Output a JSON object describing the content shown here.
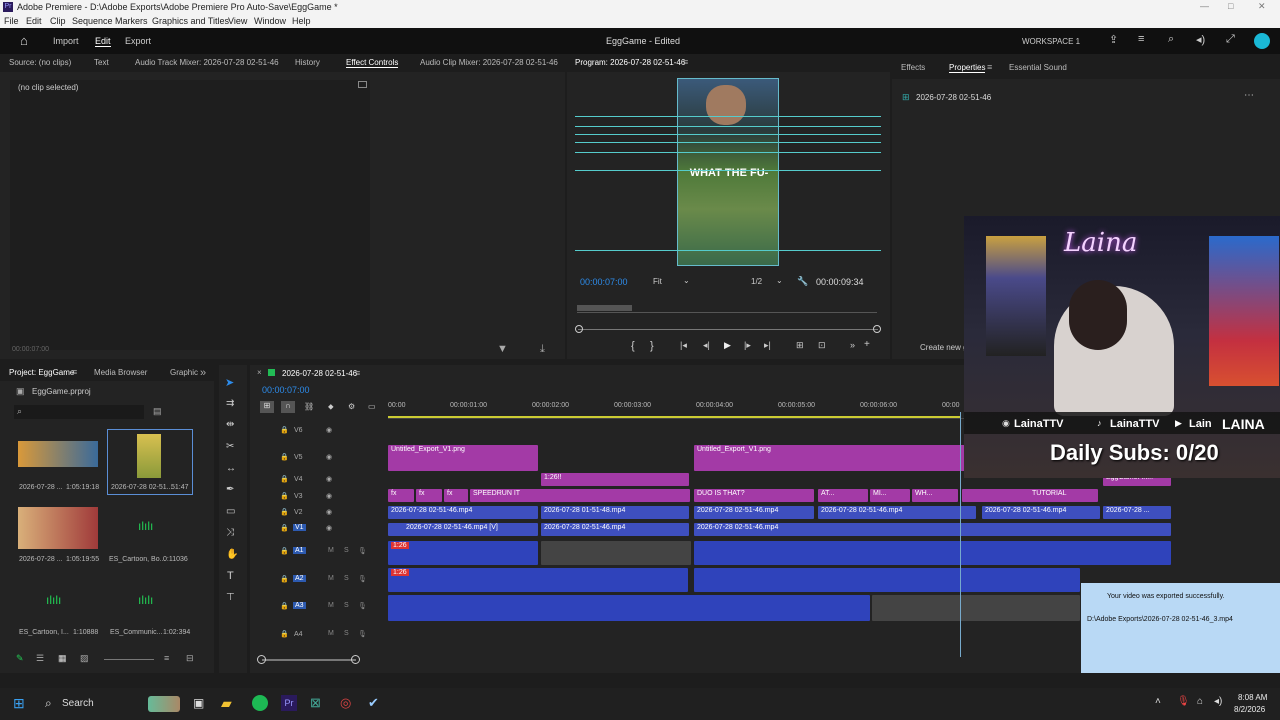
{
  "window": {
    "title": "Adobe Premiere - D:\\Adobe Exports\\Adobe Premiere Pro Auto-Save\\EggGame *",
    "controls": [
      "—",
      "□",
      "✕"
    ]
  },
  "menu": [
    "File",
    "Edit",
    "Clip",
    "Sequence",
    "Markers",
    "Graphics and Titles",
    "View",
    "Window",
    "Help"
  ],
  "appbar": {
    "nav": [
      "Import",
      "Edit",
      "Export"
    ],
    "title": "EggGame - Edited",
    "workspace": "WORKSPACE 1"
  },
  "source_panel": {
    "tabs": [
      "Source: (no clips)",
      "Text",
      "Audio Track Mixer: 2026-07-28 02-51-46",
      "History",
      "Effect Controls",
      "Audio Clip Mixer: 2026-07-28 02-51-46"
    ],
    "status": "(no clip selected)",
    "timecode": "00:00:07:00"
  },
  "program": {
    "title": "Program: 2026-07-28 02-51-46",
    "caption": "WHAT THE FU-",
    "timecode": "00:00:07:00",
    "fit": "Fit",
    "res": "1/2",
    "duration": "00:00:09:34"
  },
  "right_panel": {
    "tabs": [
      "Effects",
      "Properties",
      "Essential Sound"
    ],
    "item": "2026-07-28 02-51-46",
    "create": "Create new g"
  },
  "project": {
    "tabs": [
      "Project: EggGame",
      "Media Browser",
      "Graphic"
    ],
    "file": "EggGame.prproj",
    "items": [
      {
        "name": "2026-07-28 ...",
        "duration": "1:05:19:18"
      },
      {
        "name": "2026-07-28 02-51...",
        "duration": "51:47"
      },
      {
        "name": "2026-07-28 ...",
        "duration": "1:05:19:55"
      },
      {
        "name": "ES_Cartoon, Bo...",
        "duration": "0:11036"
      },
      {
        "name": "ES_Cartoon, I...",
        "duration": "1:10888"
      },
      {
        "name": "ES_Communic...",
        "duration": "1:02:394"
      }
    ]
  },
  "timeline": {
    "seq": "2026-07-28 02-51-46",
    "timecode": "00:00:07:00",
    "ruler": [
      "00:00",
      "00:00:01:00",
      "00:00:02:00",
      "00:00:03:00",
      "00:00:04:00",
      "00:00:05:00",
      "00:00:06:00",
      "00:00"
    ],
    "tracks": [
      "V6",
      "V5",
      "V4",
      "V3",
      "V2",
      "V1",
      "A1",
      "A2",
      "A3",
      "A4"
    ],
    "clips": {
      "v5a": "Untitled_Export_V1.png",
      "v5b": "Untitled_Export_V1.png",
      "v4a": "1:26!!",
      "v4b": "EggGameFin...",
      "v3a": "fx",
      "v3b": "fx",
      "v3c": "fx",
      "v3d": "SPEEDRUN IT",
      "v3e": "DUO IS THAT?",
      "v3f": "AT...",
      "v3g": "MI...",
      "v3h": "WH...",
      "v3i": "TUTORIAL",
      "v2a": "2026-07-28 02-51-46.mp4",
      "v2b": "2026-07-28 01-51-48.mp4",
      "v2c": "2026-07-28 02-51-46.mp4",
      "v2d": "2026-07-28 02-51-46.mp4",
      "v2e": "2026-07-28 02-51-46.mp4",
      "v2f": "2026-07-28 ...",
      "v1a": "2026-07-28 02-51-46.mp4 [V]",
      "v1b": "2026-07-28 02-51-46.mp4",
      "v1c": "2026-07-28 02-51-46.mp4",
      "a1": "1:26",
      "a2": "1:26",
      "fx": "fx"
    }
  },
  "webcam": {
    "neon": "Laina",
    "socials": [
      "LainaTTV",
      "LainaTTV",
      "Lain"
    ],
    "brand": "LAINA",
    "subs": "Daily Subs: 0/20"
  },
  "toast": {
    "title": "Your video was exported successfully.",
    "path": "D:\\Adobe Exports\\2026-07-28 02-51-46_3.mp4"
  },
  "taskbar": {
    "search": "Search",
    "time": "8:08 AM",
    "date": "8/2/2026"
  },
  "colors": {
    "accent": "#2d8ceb",
    "clip_pink": "#a33aa6",
    "clip_blue": "#3e4fbf"
  }
}
